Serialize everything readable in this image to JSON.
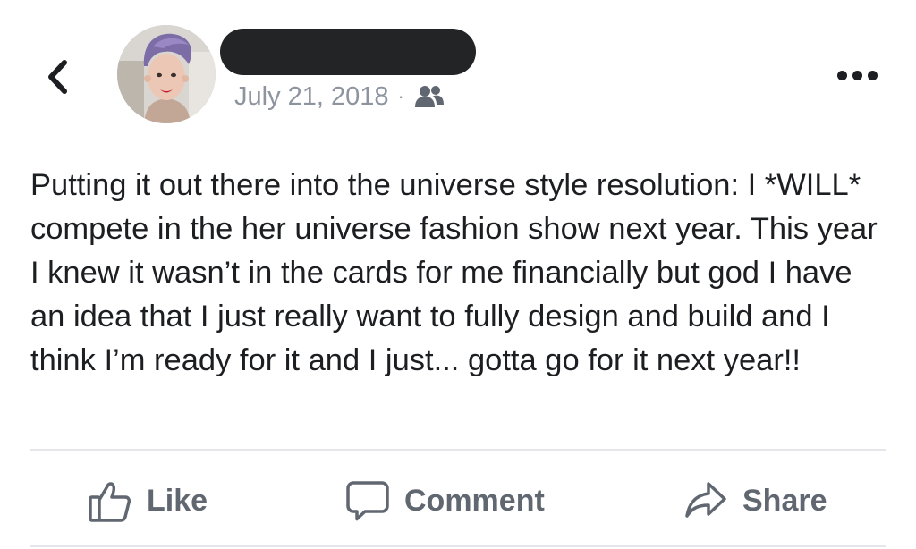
{
  "post": {
    "date": "July 21, 2018",
    "separator": "·",
    "audience_icon": "friends-icon",
    "text": "Putting it out there into the universe style resolution: I *WILL* compete in the her universe fashion show next year. This year I knew it wasn’t in the cards for me financially but god I have an idea that I just really want to fully design and build and I think I’m ready for it and I just... gotta go for it next year!!"
  },
  "actions": {
    "like_label": "Like",
    "comment_label": "Comment",
    "share_label": "Share"
  },
  "icons": {
    "back": "chevron-left-icon",
    "more": "more-horizontal-icon",
    "like": "thumbs-up-icon",
    "comment": "speech-bubble-icon",
    "share": "share-arrow-icon"
  },
  "colors": {
    "text": "#1c1e21",
    "secondary_text": "#606770",
    "meta_text": "#8d949e",
    "divider": "#e4e6eb",
    "redaction": "#222425"
  }
}
